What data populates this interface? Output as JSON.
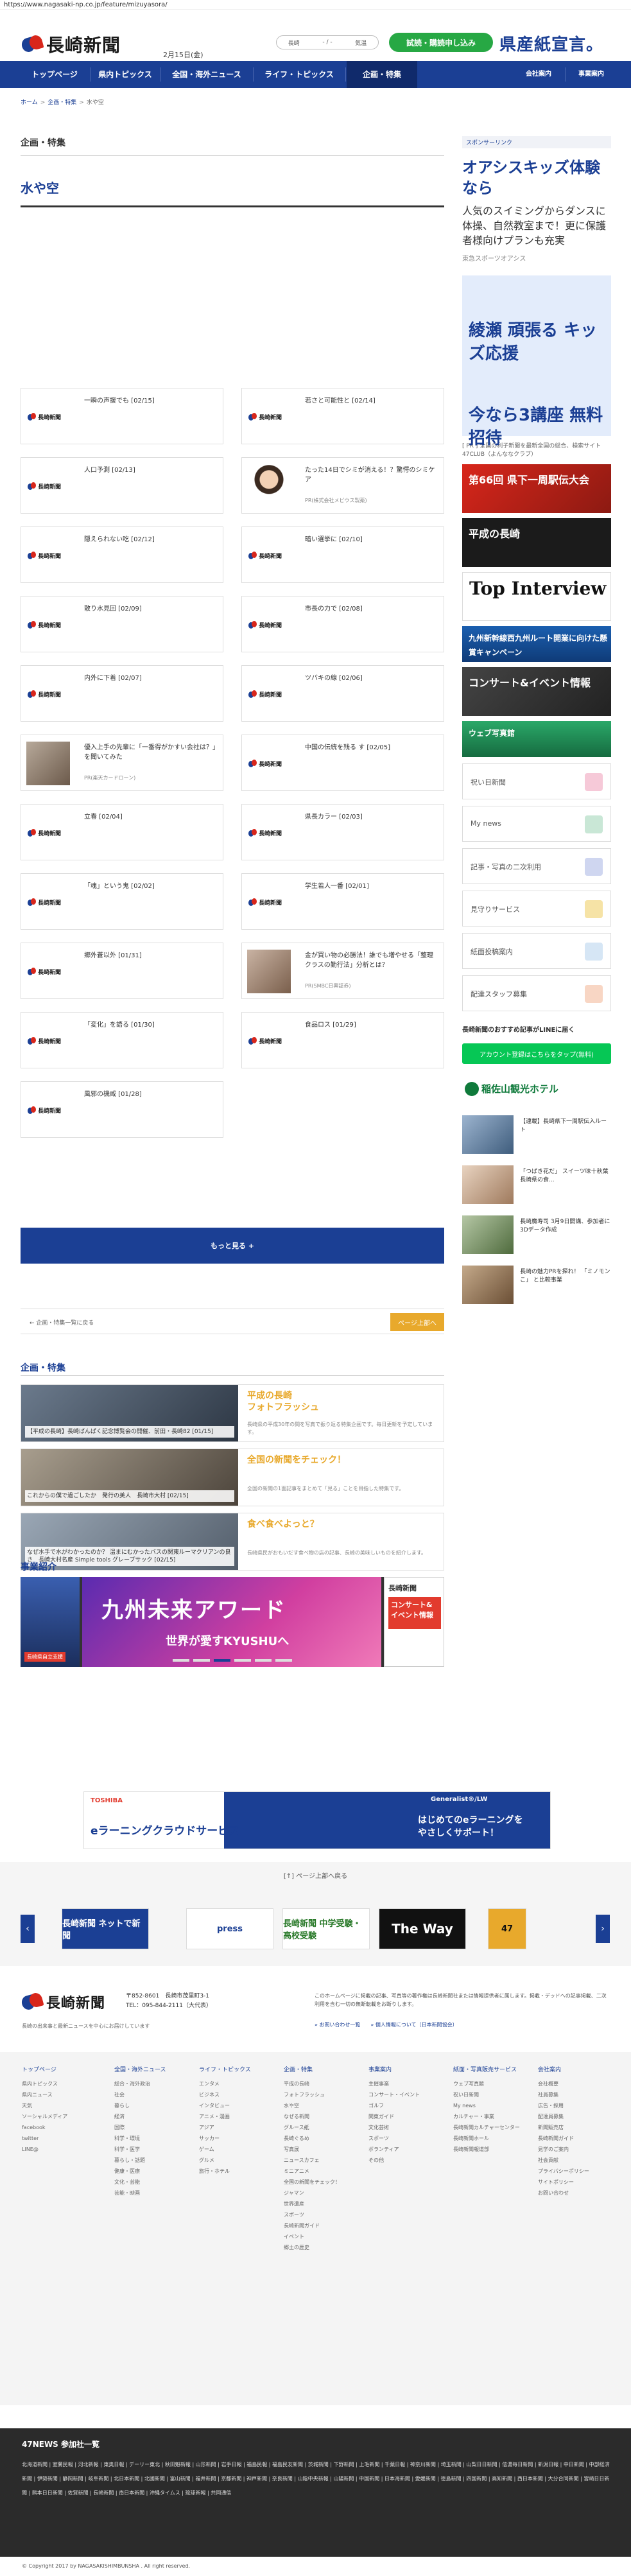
{
  "url": "https://www.nagasaki-np.co.jp/feature/mizuyasora/",
  "header": {
    "logo_text": "長崎新聞",
    "date": "2月15日(金)",
    "weather": [
      "長崎",
      "- / -",
      "気温"
    ],
    "trial_button": "試読・購読申し込み",
    "slogan": "県産紙宣言。"
  },
  "nav": {
    "items": [
      "トップページ",
      "県内トピックス",
      "全国・海外ニュース",
      "ライフ・トピックス",
      "企画・特集",
      "会社案内",
      "事業案内"
    ]
  },
  "breadcrumb": [
    "ホーム",
    "企画・特集",
    "水や空"
  ],
  "section_label": "企画・特集",
  "page_title": "水や空",
  "cards": [
    {
      "title": "一瞬の声援でも [02/15]",
      "source": "",
      "thumb": "logo"
    },
    {
      "title": "若さと可能性と [02/14]",
      "source": "",
      "thumb": "logo"
    },
    {
      "title": "人口予測 [02/13]",
      "source": "",
      "thumb": "logo"
    },
    {
      "title": "たった14日でシミが消える！？驚愕のシミケア",
      "source": "PR(株式会社メビウス製薬)",
      "thumb": "girl"
    },
    {
      "title": "隠えられない吃 [02/12]",
      "source": "",
      "thumb": "logo"
    },
    {
      "title": "暗い選挙に [02/10]",
      "source": "",
      "thumb": "logo"
    },
    {
      "title": "散り水見回 [02/09]",
      "source": "",
      "thumb": "logo"
    },
    {
      "title": "市長の力で [02/08]",
      "source": "",
      "thumb": "logo"
    },
    {
      "title": "内外に下着 [02/07]",
      "source": "",
      "thumb": "logo"
    },
    {
      "title": "ツバキの線 [02/06]",
      "source": "",
      "thumb": "logo"
    },
    {
      "title": "優入上手の先輩に「一番得がかすい会社は？」を聞いてみた",
      "source": "PR(楽天カードローン)",
      "thumb": "photo"
    },
    {
      "title": "中国の伝統を残る す [02/05]",
      "source": "",
      "thumb": "logo"
    },
    {
      "title": "立春 [02/04]",
      "source": "",
      "thumb": "logo"
    },
    {
      "title": "県長カラー [02/03]",
      "source": "",
      "thumb": "logo"
    },
    {
      "title": "「魂」という鬼 [02/02]",
      "source": "",
      "thumb": "logo"
    },
    {
      "title": "学生若人一番 [02/01]",
      "source": "",
      "thumb": "logo"
    },
    {
      "title": "郷外蒼以外 [01/31]",
      "source": "",
      "thumb": "logo"
    },
    {
      "title": "金が買い物の必勝法！誰でも増やせる「整理クラスの勤行法」分析とは？",
      "source": "PR(SMBC日興証券)",
      "thumb": "hands"
    },
    {
      "title": "「変化」を語る [01/30]",
      "source": "",
      "thumb": "logo"
    },
    {
      "title": "食品ロス [01/29]",
      "source": "",
      "thumb": "logo"
    },
    {
      "title": "風邪の機威 [01/28]",
      "source": "",
      "thumb": "logo"
    }
  ],
  "more_button": "もっと見る +",
  "pager": {
    "back": "← 企画・特集一覧に戻る",
    "up": "ページ上部へ"
  },
  "features_title": "企画・特集",
  "features": [
    {
      "caption": "【平成の長崎】長崎ばんぱく記念博覧会の開催、前田・長崎82 [01/15]",
      "title": "平成の長崎\nフォトフラッシュ",
      "desc": "長崎県の平成30年の間を写真で振り返る特集企画です。毎日更新を予定しています。"
    },
    {
      "caption": "これからの僕で過ごしたか　発行の美人　長崎市大村 [02/15]",
      "title": "全国の新聞をチェック！",
      "desc": "全国の新聞の1面記事をまとめて「見る」ことを目指した特集です。"
    },
    {
      "caption": "なぜ水手で水がわかったのか？ 温まにむかったバスの関東ルーマクリアンの良さ　長崎大村名産 Simple tools グレープサック [02/15]",
      "title": "食べ食べよっと？",
      "desc": "長崎県民がおもいだす食べ物の店の記事、長崎の美味しいものを紹介します。"
    }
  ],
  "biz_title": "事業紹介",
  "biz_banner": {
    "left_tag": "長崎県自立支援",
    "main_line1": "九州未来アワード",
    "main_line2": "世界が愛すKYUSHUへ",
    "right_logo": "長崎新聞",
    "right_text": "コンサート&イベント情報"
  },
  "sidebar": {
    "sponsored_label": "スポンサーリンク",
    "ad1_heading": "オアシスキッズ体験なら",
    "ad1_body": "人気のスイミングからダンスに体操、自然教室まで！更に保護者様向けプランも充実",
    "ad1_source": "東急スポーツオアシス",
    "ad2_line1": "綾瀬 頑張る キッズ応援",
    "ad2_line2": "今なら3講座 無料招待",
    "ad_note": "[ PR ] 全国の利子新聞を最新全国の総合、検索サイト47CLUB（よんななクラブ）",
    "banners": [
      "第66回 県下一周駅伝大会",
      "平成の長崎",
      "Top Interview",
      "九州新幹線西九州ルート開業に向けた懸賞キャンペーン",
      "コンサート&イベント情報",
      "ウェブ写真館"
    ],
    "links": [
      "祝い日新聞",
      "My news",
      "記事・写真の二次利用",
      "見守りサービス",
      "紙面投稿案内",
      "配達スタッフ募集"
    ],
    "line_title": "長崎新聞のおすすめ記事がLINEに届く",
    "line_button": "アカウント登録はこちらをタップ(無料)",
    "hotel": "稲佐山観光ホテル",
    "side_news": [
      "【連載】長崎県下一周駅伝入ルート",
      "「つばき花だ」 スイーツ味十秋葉　長崎県の食...",
      "長崎魔寿司 3月9日開講、参加者に3Dデータ作成",
      "長崎の魅力PRを探れ！ 「ミノモンこ」 と比較事業"
    ]
  },
  "ad_band": {
    "brand": "TOSHIBA",
    "title": "eラーニングクラウドサービス",
    "right_brand": "Generalist®/LW",
    "right_text": "はじめてのeラーニングを\nやさしくサポート！"
  },
  "page_top": "[↑] ページ上部へ戻る",
  "carousel": [
    "長崎新聞 ネットで新聞",
    "press",
    "長崎新聞 中学受験・高校受験",
    "The Way",
    "47"
  ],
  "footer": {
    "logo_text": "長崎新聞",
    "address": "〒852-8601　長崎市茂里町3-1\nTEL：095-844-2111（大代表）",
    "intro": "長崎の出来事と最新ニュースを中心にお届けしています",
    "note": "このホームページに掲載の記事、写真等の著作権は長崎新聞社または情報提供者に属します。掲載・デッドへの記事掲載、二次利用を含む一切の無断転載をお断りします。",
    "links": "» お問い合わせ一覧　　» 個人情報について（日本新聞協会）",
    "columns": [
      {
        "head": "トップページ",
        "items": [
          "県内トピックス",
          "県内ニュース",
          "天気",
          "ソーシャルメディア",
          "facebook",
          "twitter",
          "LINE@"
        ]
      },
      {
        "head": "全国・海外ニュース",
        "items": [
          "総合・海外政治",
          "社会",
          "暮らし",
          "経済",
          "国際",
          "科学・環境",
          "科学・医学",
          "暮らし・話題",
          "健康・医療",
          "文化・芸能",
          "芸能・映画"
        ]
      },
      {
        "head": "ライフ・トピックス",
        "items": [
          "エンタメ",
          "ビジネス",
          "インタビュー",
          "アニメ・漫画",
          "アジア",
          "サッカー",
          "ゲーム",
          "グルメ",
          "旅行・ホテル"
        ]
      },
      {
        "head": "企画・特集",
        "items": [
          "平成の長崎",
          "フォトフラッシュ",
          "水や空",
          "なぜる新聞",
          "グルース紙",
          "長崎ぐるめ",
          "写真展",
          "ニュースカフェ",
          "ミニアニメ",
          "全国の新聞をチェック！",
          "ジャマン",
          "世界遺産",
          "スポーツ",
          "長崎新聞ガイド",
          "イベント",
          "郷土の歴史"
        ]
      },
      {
        "head": "事業案内",
        "items": [
          "主催事業",
          "コンサート・イベント",
          "ゴルフ",
          "関東ガイド",
          "文化芸術",
          "スポーツ",
          "ボランティア",
          "その他"
        ]
      },
      {
        "head": "紙面・写真販売サービス",
        "items": [
          "ウェブ写真館",
          "祝い日新聞",
          "My news",
          "カルチャー・事業",
          "長崎新聞カルチャーセンター",
          "長崎新聞ホール",
          "長崎新聞報道部"
        ]
      },
      {
        "head": "会社案内",
        "items": [
          "会社概要",
          "社員募集",
          "広告・採用",
          "配達員募集",
          "新聞販売店",
          "長崎新聞ガイド",
          "見学のご案内",
          "社会貢献",
          "プライバシーポリシー",
          "サイトポリシー",
          "お問い合わせ"
        ]
      }
    ]
  },
  "news47": {
    "title": "47NEWS 参加社一覧",
    "rows": "北海道新聞 | 室蘭民報 | 河北新報 | 東奥日報 | デーリー東北 | 秋田魁新報 | 山形新聞 | 岩手日報 | 福島民報 | 福島民友新聞 | 茨城新聞 | 下野新聞 | 上毛新聞 | 千葉日報 | 神奈川新聞 | 埼玉新聞 | 山梨日日新聞 | 信濃毎日新聞 | 新潟日報 | 中日新聞 | 中部経済新聞 | 伊勢新聞 | 静岡新聞 | 岐阜新聞 | 北日本新聞 | 北國新聞 | 富山新聞 | 福井新聞 | 京都新聞 | 神戸新聞 | 奈良新聞 | 山陰中央新報 | 山陽新聞 | 中国新聞 | 日本海新聞 | 愛媛新聞 | 徳島新聞 | 四国新聞 | 高知新聞 | 西日本新聞 | 大分合同新聞 | 宮崎日日新聞 | 熊本日日新聞 | 佐賀新聞 | 長崎新聞 | 南日本新聞 | 沖縄タイムス | 琉球新報 | 共同通信"
  },
  "copyright": "© Copyright 2017 by NAGASAKISHIMBUNSHA . All right reserved."
}
